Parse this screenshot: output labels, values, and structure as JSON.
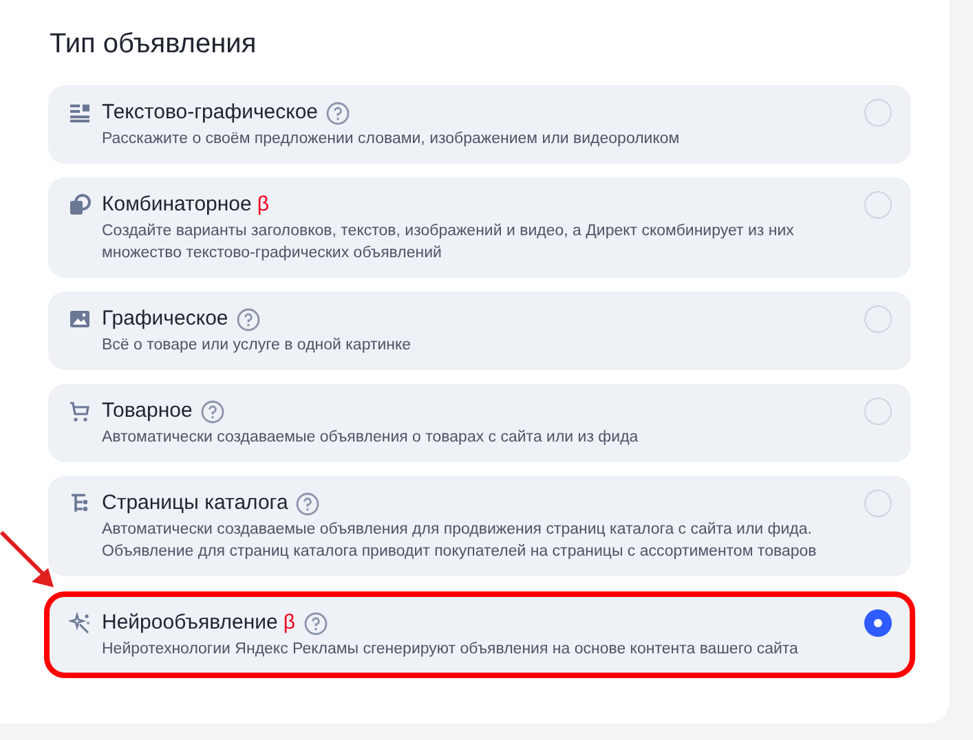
{
  "title": "Тип объявления",
  "options": [
    {
      "kind": "text",
      "title": "Текстово-графическое",
      "help": true,
      "description": "Расскажите о своём предложении словами, изображением или видеороликом",
      "selected": false,
      "highlighted": false
    },
    {
      "kind": "combo",
      "title": "Комбинаторное",
      "badge": "β",
      "help": false,
      "description": "Создайте варианты заголовков, текстов, изображений и видео, а Директ скомбинирует из них множество текстово-графических объявлений",
      "selected": false,
      "highlighted": false
    },
    {
      "kind": "image",
      "title": "Графическое",
      "help": true,
      "description": "Всё о товаре или услуге в одной картинке",
      "selected": false,
      "highlighted": false
    },
    {
      "kind": "cart",
      "title": "Товарное",
      "help": true,
      "description": "Автоматически создаваемые объявления о товарах с сайта или из фида",
      "selected": false,
      "highlighted": false
    },
    {
      "kind": "catalog",
      "title": "Страницы каталога",
      "help": true,
      "description": "Автоматически создаваемые объявления для продвижения страниц каталога с сайта или фида. Объявление для страниц каталога приводит покупателей на страницы с ассортиментом товаров",
      "selected": false,
      "highlighted": false
    },
    {
      "kind": "neuro",
      "title": "Нейрообъявление",
      "badge": "β",
      "help": true,
      "description": "Нейротехнологии Яндекс Рекламы сгенерируют объявления на основе контента вашего сайта",
      "selected": true,
      "highlighted": true
    }
  ]
}
